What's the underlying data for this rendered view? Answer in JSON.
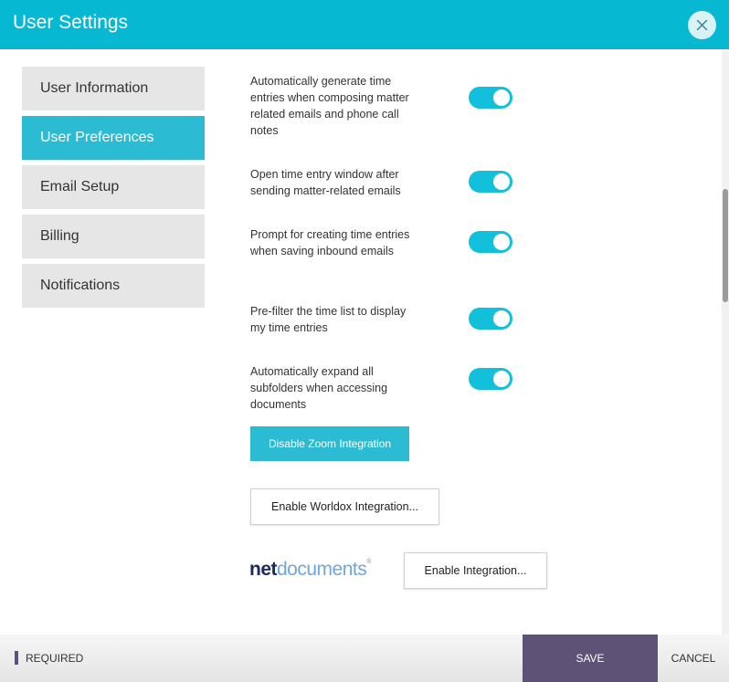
{
  "header": {
    "title": "User Settings"
  },
  "sidebar": {
    "items": [
      {
        "label": "User Information",
        "active": false
      },
      {
        "label": "User Preferences",
        "active": true
      },
      {
        "label": "Email Setup",
        "active": false
      },
      {
        "label": "Billing",
        "active": false
      },
      {
        "label": "Notifications",
        "active": false
      }
    ]
  },
  "preferences": [
    {
      "text": "Automatically generate time entries when composing matter related emails and phone call notes",
      "enabled": true
    },
    {
      "text": "Open time entry window after sending matter-related emails",
      "enabled": true
    },
    {
      "text": "Prompt for creating time entries when saving inbound emails",
      "enabled": true
    },
    {
      "text": "Pre-filter the time list to display my time entries",
      "enabled": true
    },
    {
      "text": "Automatically expand all subfolders when accessing documents",
      "enabled": true
    }
  ],
  "integrations": {
    "zoom_label": "Disable Zoom Integration",
    "worldox_label": "Enable Worldox Integration...",
    "netdocuments_logo_net": "net",
    "netdocuments_logo_docs": "documents",
    "netdocuments_label": "Enable Integration..."
  },
  "footer": {
    "required_label": "REQUIRED",
    "save_label": "SAVE",
    "cancel_label": "CANCEL"
  },
  "colors": {
    "header": "#07b8d3",
    "accent": "#2bbcd3",
    "toggle_on": "#12c0dc",
    "save": "#5e5277"
  },
  "icons": {
    "close": "close-icon",
    "required_marker": "required-marker-icon"
  }
}
